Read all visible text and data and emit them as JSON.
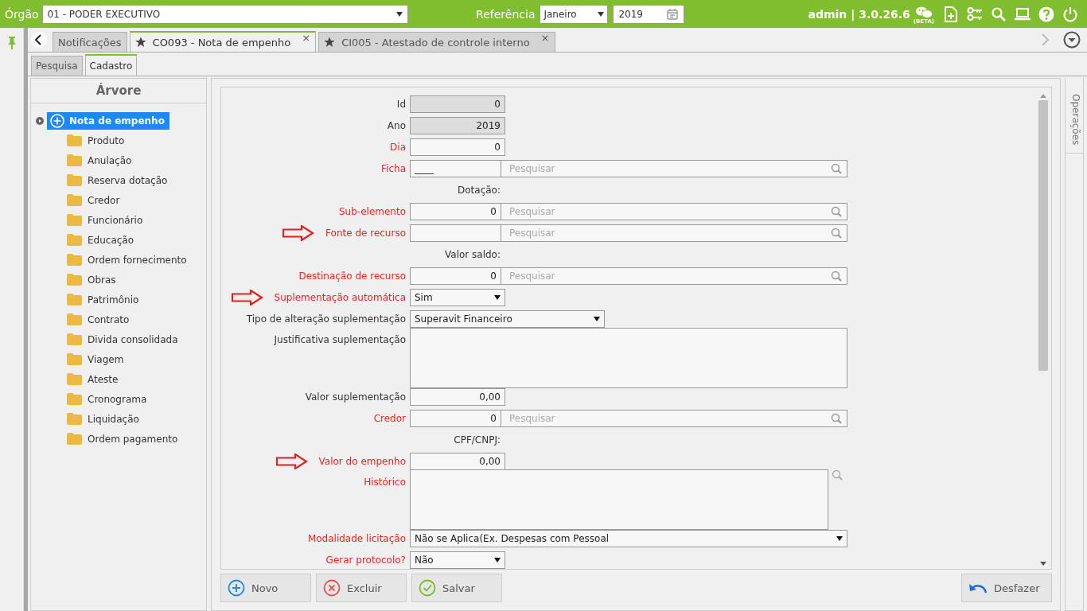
{
  "header": {
    "orgao_label": "Órgão",
    "orgao_value": "01 - PODER EXECUTIVO",
    "referencia_label": "Referência",
    "month": "Janeiro",
    "year": "2019",
    "user": "admin | 3.0.26.6",
    "beta_label": "(BETA)"
  },
  "doc_tabs": [
    {
      "label": "Notificações",
      "starred": false,
      "selected": false
    },
    {
      "label": "CO093 - Nota de empenho",
      "starred": true,
      "close": "×",
      "selected": true
    },
    {
      "label": "CI005 - Atestado de controle interno",
      "starred": true,
      "close": "×",
      "selected": false
    }
  ],
  "sub_tabs": [
    {
      "label": "Pesquisa",
      "selected": false
    },
    {
      "label": "Cadastro",
      "selected": true
    }
  ],
  "tree": {
    "title": "Árvore",
    "root": {
      "label": "Nota de empenho",
      "selected": true,
      "children": [
        {
          "label": "Produto"
        },
        {
          "label": "Anulação"
        },
        {
          "label": "Reserva dotação"
        },
        {
          "label": "Credor"
        },
        {
          "label": "Funcionário"
        },
        {
          "label": "Educação"
        },
        {
          "label": "Ordem fornecimento"
        },
        {
          "label": "Obras"
        },
        {
          "label": "Patrimônio"
        },
        {
          "label": "Contrato"
        },
        {
          "label": "Divida consolidada"
        },
        {
          "label": "Viagem"
        },
        {
          "label": "Ateste"
        },
        {
          "label": "Cronograma"
        },
        {
          "label": "Liquidação"
        },
        {
          "label": "Ordem pagamento"
        }
      ]
    }
  },
  "form": {
    "rows": [
      {
        "kind": "readonly",
        "label": "Id",
        "required": false,
        "marked": false,
        "value": "0"
      },
      {
        "kind": "readonly",
        "label": "Ano",
        "required": false,
        "marked": false,
        "value": "2019"
      },
      {
        "kind": "input",
        "label": "Dia",
        "required": true,
        "marked": false,
        "value": "0"
      },
      {
        "kind": "lookup_text",
        "label": "Ficha",
        "required": true,
        "marked": false,
        "value": "____",
        "placeholder": "Pesquisar"
      },
      {
        "kind": "caption",
        "label": "Dotação:"
      },
      {
        "kind": "lookup",
        "label": "Sub-elemento",
        "required": true,
        "marked": false,
        "value": "0",
        "placeholder": "Pesquisar"
      },
      {
        "kind": "lookup",
        "label": "Fonte de recurso",
        "required": true,
        "marked": true,
        "placeholder": "Pesquisar"
      },
      {
        "kind": "caption",
        "label": "Valor saldo:"
      },
      {
        "kind": "lookup",
        "label": "Destinação de recurso",
        "required": true,
        "marked": false,
        "value": "0",
        "placeholder": "Pesquisar"
      },
      {
        "kind": "select",
        "label": "Suplementação automática",
        "required": true,
        "marked": true,
        "value": "Sim"
      },
      {
        "kind": "select_wide",
        "label": "Tipo de alteração suplementação",
        "required": false,
        "marked": false,
        "value": "Superavit Financeiro"
      },
      {
        "kind": "textarea",
        "label": "Justificativa suplementação",
        "required": false,
        "marked": false
      },
      {
        "kind": "input",
        "label": "Valor suplementação",
        "required": false,
        "marked": false,
        "value": "0,00"
      },
      {
        "kind": "lookup",
        "label": "Credor",
        "required": true,
        "marked": false,
        "value": "0",
        "placeholder": "Pesquisar"
      },
      {
        "kind": "caption",
        "label": "CPF/CNPJ:"
      },
      {
        "kind": "input",
        "label": "Valor do empenho",
        "required": true,
        "marked": true,
        "value": "0,00"
      },
      {
        "kind": "textarea_search",
        "label": "Histórico",
        "required": true,
        "marked": false
      },
      {
        "kind": "select_full",
        "label": "Modalidade licitação",
        "required": true,
        "marked": false,
        "value": "Não se Aplica(Ex. Despesas com Pessoal"
      },
      {
        "kind": "select",
        "label": "Gerar protocolo?",
        "required": true,
        "marked": false,
        "value": "Não"
      }
    ]
  },
  "buttons": [
    {
      "label": "Novo",
      "kind": "add"
    },
    {
      "label": "Excluir",
      "kind": "delete"
    },
    {
      "label": "Salvar",
      "kind": "save"
    }
  ],
  "undo_button": {
    "label": "Desfazer"
  },
  "side_panel": {
    "label": "Operações"
  }
}
